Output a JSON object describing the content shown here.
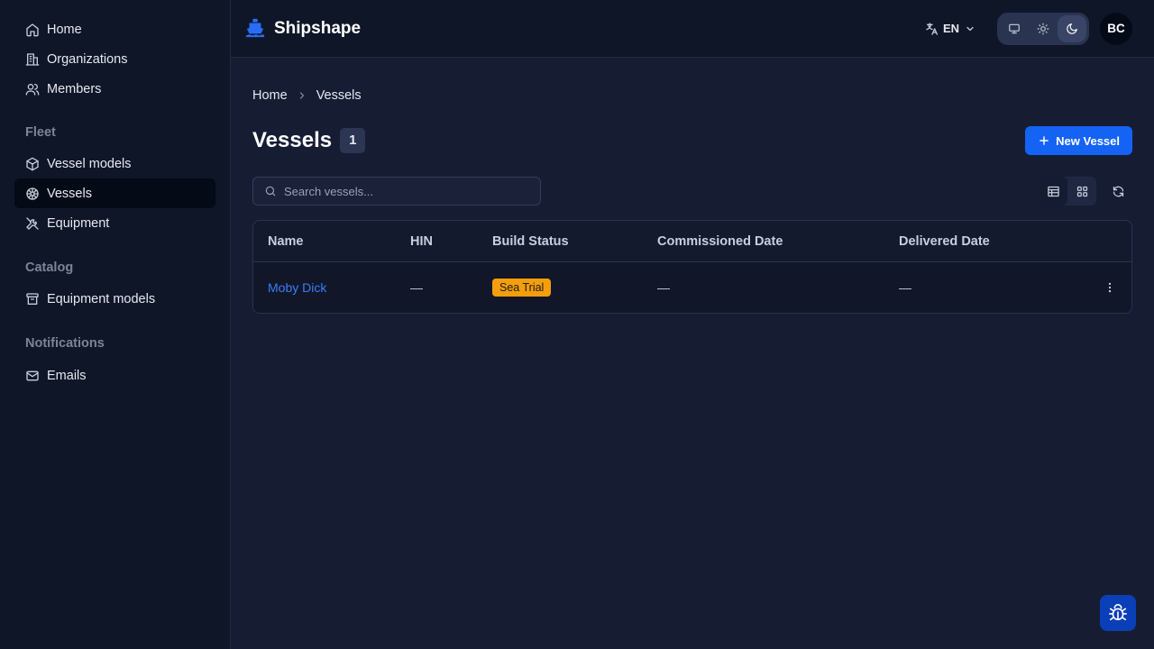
{
  "sidebar": {
    "top_items": [
      {
        "label": "Home",
        "icon": "home-icon"
      },
      {
        "label": "Organizations",
        "icon": "building-icon"
      },
      {
        "label": "Members",
        "icon": "users-icon"
      }
    ],
    "sections": [
      {
        "title": "Fleet",
        "items": [
          {
            "label": "Vessel models",
            "icon": "box-icon"
          },
          {
            "label": "Vessels",
            "icon": "wheel-icon",
            "active": true
          },
          {
            "label": "Equipment",
            "icon": "tools-icon"
          }
        ]
      },
      {
        "title": "Catalog",
        "items": [
          {
            "label": "Equipment models",
            "icon": "archive-icon"
          }
        ]
      },
      {
        "title": "Notifications",
        "items": [
          {
            "label": "Emails",
            "icon": "mail-icon"
          }
        ]
      }
    ]
  },
  "header": {
    "brand": "Shipshape",
    "language": "EN",
    "avatar_initials": "BC",
    "theme_active": "dark"
  },
  "breadcrumb": [
    "Home",
    "Vessels"
  ],
  "page": {
    "title": "Vessels",
    "count": "1",
    "new_button": "New Vessel"
  },
  "search": {
    "placeholder": "Search vessels...",
    "value": ""
  },
  "table": {
    "columns": [
      "Name",
      "HIN",
      "Build Status",
      "Commissioned Date",
      "Delivered Date"
    ],
    "rows": [
      {
        "name": "Moby Dick",
        "hin": "—",
        "status": "Sea Trial",
        "commissioned": "—",
        "delivered": "—"
      }
    ]
  },
  "colors": {
    "accent": "#1463f5",
    "status_sea_trial": "#f59e0b",
    "link": "#3d7cf8"
  }
}
